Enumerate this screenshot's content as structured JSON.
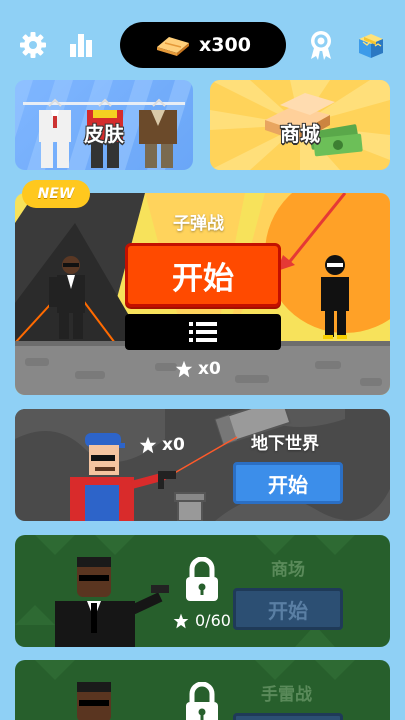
{
  "topbar": {
    "coins": "x300",
    "icons": [
      "gear-icon",
      "stats-icon",
      "medal-icon",
      "shop-box-icon"
    ]
  },
  "cards": {
    "skin_label": "皮肤",
    "mall_label": "商城"
  },
  "bullet": {
    "badge": "NEW",
    "title": "子弹战",
    "start": "开始",
    "stars": "x0"
  },
  "underworld": {
    "title": "地下世界",
    "start": "开始",
    "stars": "x0"
  },
  "mall_mode": {
    "title": "商场",
    "start": "开始",
    "progress": "0/60"
  },
  "grenade_mode": {
    "title": "手雷战"
  },
  "colors": {
    "background": "#8fd0f5",
    "start_red": "#ff4a00",
    "start_blue": "#3c8eea",
    "locked_green": "#275f2c"
  }
}
